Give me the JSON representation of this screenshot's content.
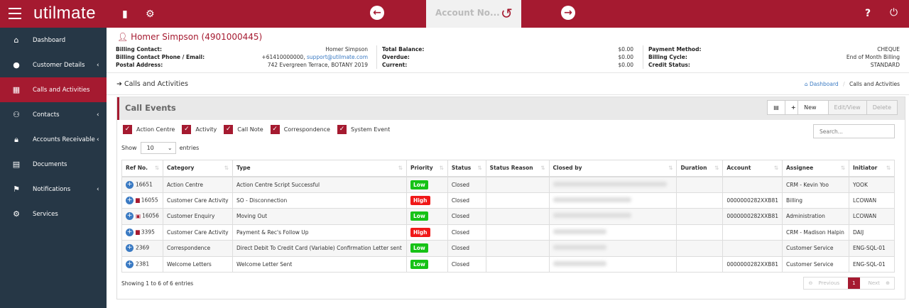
{
  "app": {
    "logo": "utilmate",
    "account_search": "Account No...",
    "undo_icon": "undo-icon"
  },
  "sidebar": [
    {
      "label": "Dashboard",
      "icon": "home-icon",
      "chev": false
    },
    {
      "label": "Customer Details",
      "icon": "user-icon",
      "chev": true
    },
    {
      "label": "Calls and Activities",
      "icon": "calendar-icon",
      "chev": false,
      "active": true
    },
    {
      "label": "Contacts",
      "icon": "users-icon",
      "chev": true
    },
    {
      "label": "Accounts Receivable",
      "icon": "lock-icon",
      "chev": true
    },
    {
      "label": "Documents",
      "icon": "file-icon",
      "chev": false
    },
    {
      "label": "Notifications",
      "icon": "flag-icon",
      "chev": true
    },
    {
      "label": "Services",
      "icon": "cogs-icon",
      "chev": false
    }
  ],
  "customer": {
    "name": "Homer Simpson (4901000445)",
    "billing_contact_label": "Billing Contact:",
    "billing_contact": "Homer Simpson",
    "phone_label": "Billing Contact Phone / Email:",
    "phone": "+61410000000,",
    "email": "support@utilmate.com",
    "postal_label": "Postal Address:",
    "postal": "742 Evergreen Terrace, BOTANY 2019",
    "total_balance_label": "Total Balance:",
    "total_balance": "$0.00",
    "overdue_label": "Overdue:",
    "overdue": "$0.00",
    "current_label": "Current:",
    "current": "$0.00",
    "payment_method_label": "Payment Method:",
    "payment_method": "CHEQUE",
    "billing_cycle_label": "Billing Cycle:",
    "billing_cycle": "End of Month Billing",
    "credit_status_label": "Credit Status:",
    "credit_status": "STANDARD"
  },
  "page": {
    "title": "Calls and Activities",
    "breadcrumb_home": "Dashboard",
    "breadcrumb_current": "Calls and Activities"
  },
  "panel": {
    "title": "Call Events",
    "new": "New",
    "edit": "Edit/View",
    "delete": "Delete",
    "filters": [
      "Action Centre",
      "Activity",
      "Call Note",
      "Correspondence",
      "System Event"
    ],
    "show": "Show",
    "entries_value": "10",
    "entries": "entries",
    "search_placeholder": "Search...",
    "info": "Showing 1 to 6 of 6 entries",
    "prev": "Previous",
    "page": "1",
    "next": "Next"
  },
  "table": {
    "columns": [
      "Ref No.",
      "Category",
      "Type",
      "Priority",
      "Status",
      "Status Reason",
      "Closed by",
      "Duration",
      "Account",
      "Assignee",
      "Initiator"
    ],
    "rows": [
      {
        "ref": "16651",
        "icon": "",
        "category": "Action Centre",
        "type": "Action Centre Script Successful",
        "priority": "Low",
        "status": "Closed",
        "reason": "",
        "duration": "",
        "account": "",
        "assignee": "CRM - Kevin Yoo",
        "initiator": "YOOK"
      },
      {
        "ref": "16055",
        "icon": "calendar",
        "category": "Customer Care Activity",
        "type": "SO - Disconnection",
        "priority": "High",
        "status": "Closed",
        "reason": "",
        "duration": "",
        "account": "0000000282XXB81",
        "assignee": "Billing",
        "initiator": "LCOWAN"
      },
      {
        "ref": "16056",
        "icon": "phone",
        "category": "Customer Enquiry",
        "type": "Moving Out",
        "priority": "Low",
        "status": "Closed",
        "reason": "",
        "duration": "",
        "account": "0000000282XXB81",
        "assignee": "Administration",
        "initiator": "LCOWAN"
      },
      {
        "ref": "3395",
        "icon": "calendar",
        "category": "Customer Care Activity",
        "type": "Payment & Rec's Follow Up",
        "priority": "High",
        "status": "Closed",
        "reason": "",
        "duration": "",
        "account": "",
        "assignee": "CRM - Madison Halpin",
        "initiator": "DAIJ"
      },
      {
        "ref": "2369",
        "icon": "",
        "category": "Correspondence",
        "type": "Direct Debit To Credit Card (Variable) Confirmation Letter sent",
        "priority": "Low",
        "status": "Closed",
        "reason": "",
        "duration": "",
        "account": "",
        "assignee": "Customer Service",
        "initiator": "ENG-SQL-01"
      },
      {
        "ref": "2381",
        "icon": "",
        "category": "Welcome Letters",
        "type": "Welcome Letter Sent",
        "priority": "Low",
        "status": "Closed",
        "reason": "",
        "duration": "",
        "account": "0000000282XXB81",
        "assignee": "Customer Service",
        "initiator": "ENG-SQL-01"
      }
    ]
  },
  "colors": {
    "brand": "#a51a30",
    "sidebar": "#263746",
    "low": "#16c216",
    "high": "#f01818"
  }
}
